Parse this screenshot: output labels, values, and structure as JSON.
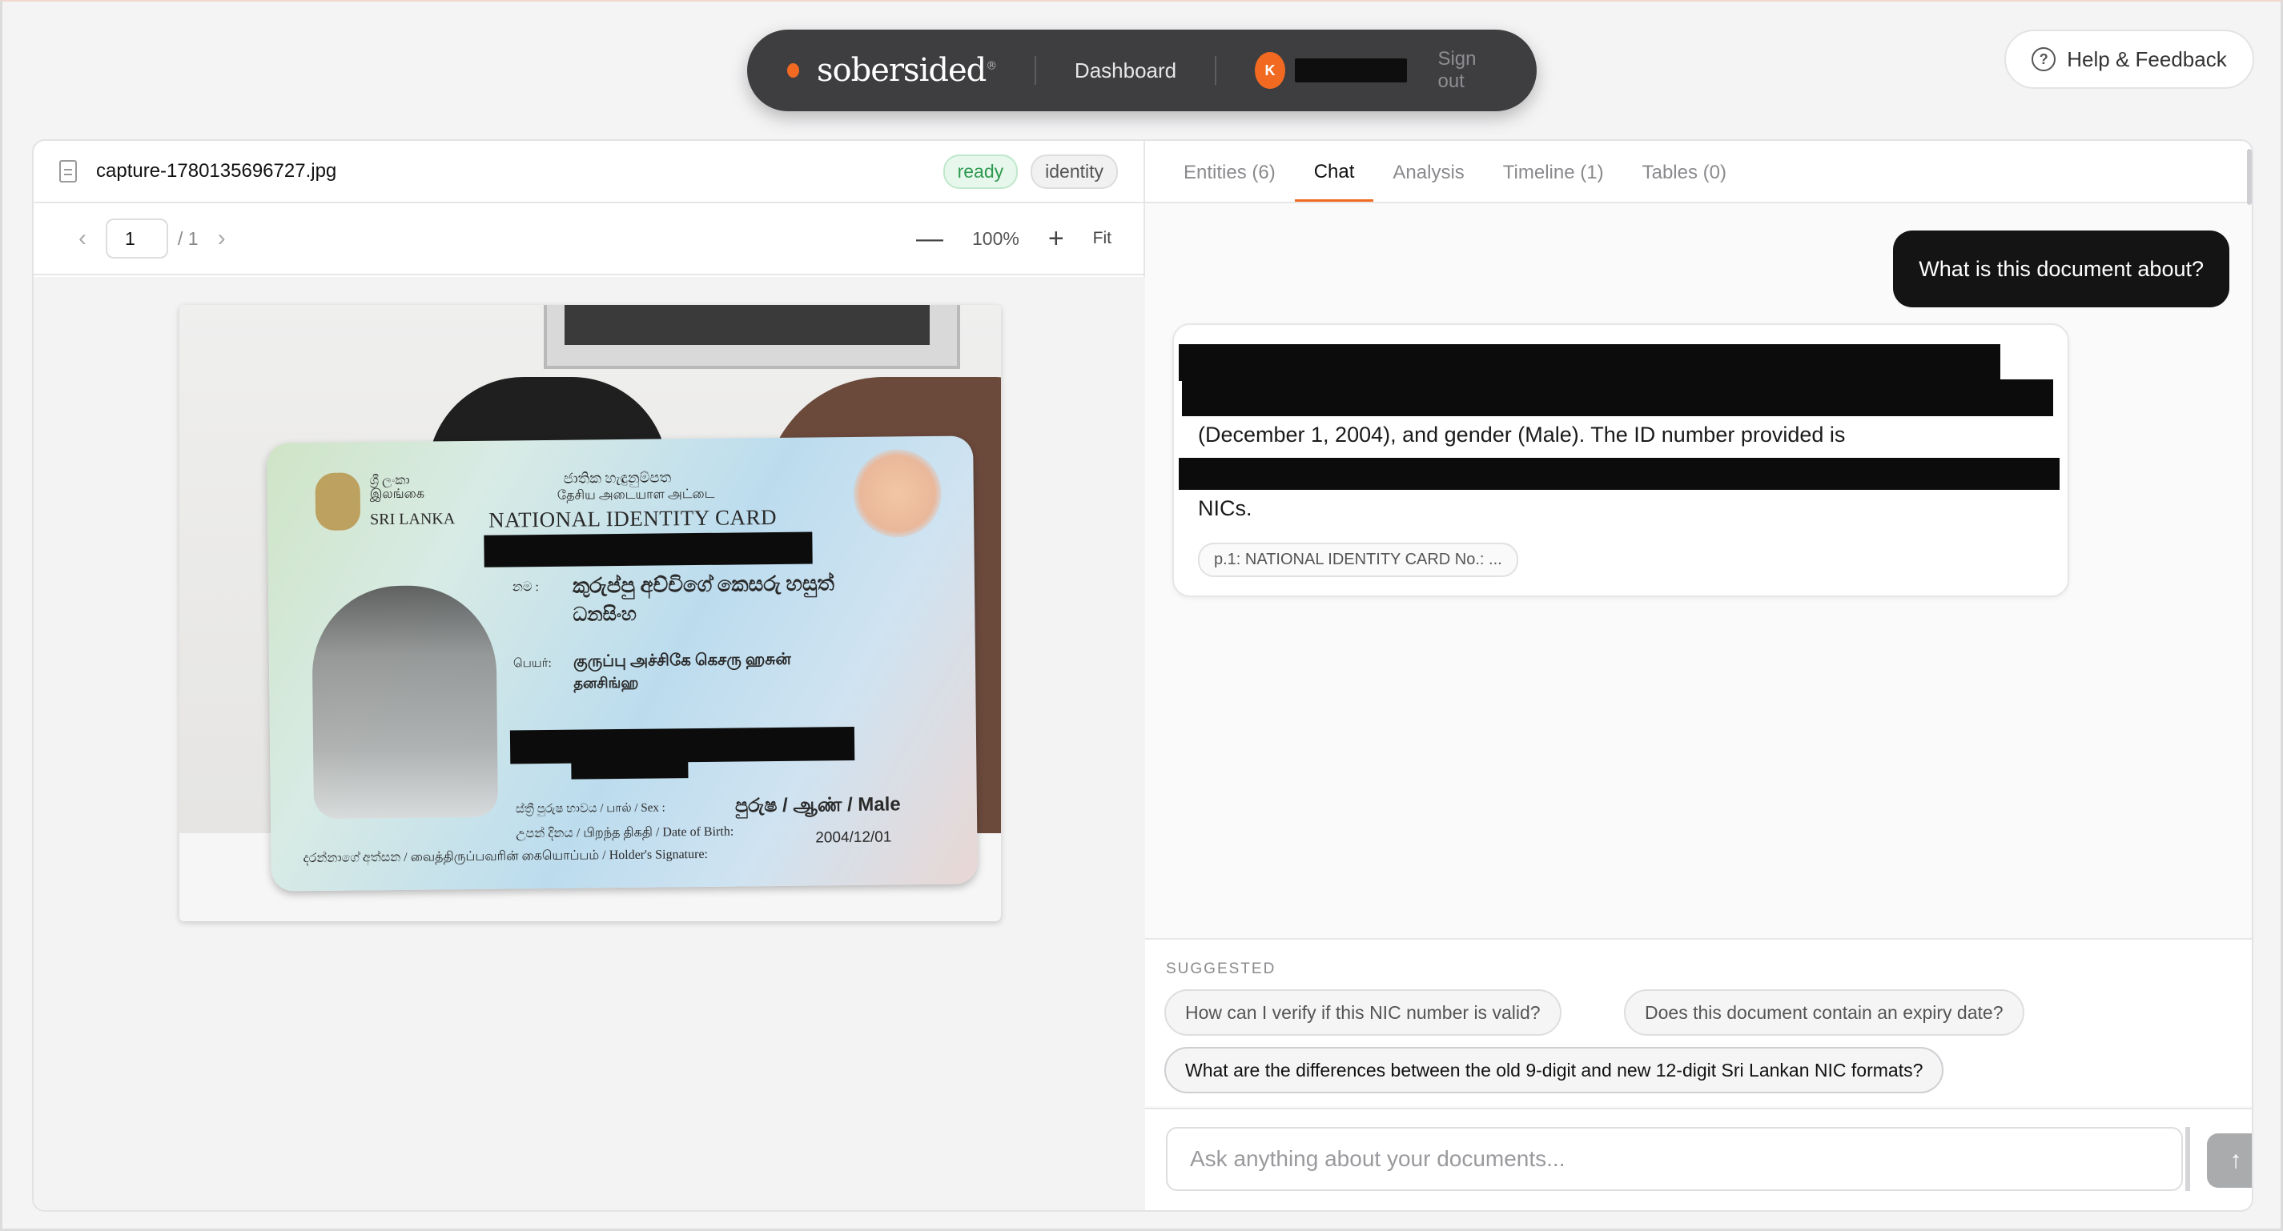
{
  "nav": {
    "brand": "sobersided",
    "brand_mark": "•",
    "dashboard": "Dashboard",
    "avatar_initial": "K",
    "signout": "Sign out"
  },
  "help": {
    "label": "Help & Feedback",
    "icon": "question-circle-icon"
  },
  "document": {
    "filename": "capture-1780135696727.jpg",
    "status": "ready",
    "type": "identity",
    "page_current": "1",
    "page_total": "/ 1",
    "zoom": "100%",
    "fit_label": "Fit"
  },
  "card": {
    "sinhala_country": "ශ්‍රී ලංකා\nஇலங்கை",
    "country": "SRI LANKA",
    "header_si": "ජාතික හැඳුනුම්පත",
    "header_ta": "தேசிய அடையாள அட்டை",
    "title": "NATIONAL IDENTITY CARD",
    "name_label": "නම :",
    "name_si": "කුරුප්පු අච්චිගේ කෙසරු හසුත්",
    "name_si_2": "ධනසිංහ",
    "name_ta_label": "பெயர்:",
    "name_ta": "குருப்பு அச்சிகே கெசரு ஹசுன்",
    "name_ta_2": "தனசிங்ஹ",
    "sex_label": "ස්ත්‍රී පුරුෂ භාවය / பால் / Sex :",
    "sex_value": "පුරුෂ / ஆண் / Male",
    "dob_label": "උපන් දිනය / பிறந்த திகதி / Date of Birth:",
    "dob_value": "2004/12/01",
    "sig_label": "දරන්නාගේ අත්සන / வைத்திருப்பவரின் கையொப்பம் / Holder's Signature:"
  },
  "tabs": [
    {
      "label": "Entities (6)"
    },
    {
      "label": "Chat"
    },
    {
      "label": "Analysis"
    },
    {
      "label": "Timeline (1)"
    },
    {
      "label": "Tables (0)"
    }
  ],
  "chat": {
    "user_message": "What is this document about?",
    "ai_line_1": "(December 1, 2004), and gender (Male). The ID number provided is",
    "ai_line_2": "NICs.",
    "citation": "p.1: NATIONAL IDENTITY CARD No.: ..."
  },
  "suggested": {
    "label": "SUGGESTED",
    "items": [
      "How can I verify if this NIC number is valid?",
      "Does this document contain an expiry date?",
      "What are the differences between the old 9-digit and new 12-digit Sri Lankan NIC formats?"
    ]
  },
  "composer": {
    "placeholder": "Ask anything about your documents...",
    "send_icon": "arrow-up-icon"
  },
  "colors": {
    "accent": "#f26a22",
    "nav_bg": "#3e3e40",
    "ready_green": "#2e9a4f"
  }
}
